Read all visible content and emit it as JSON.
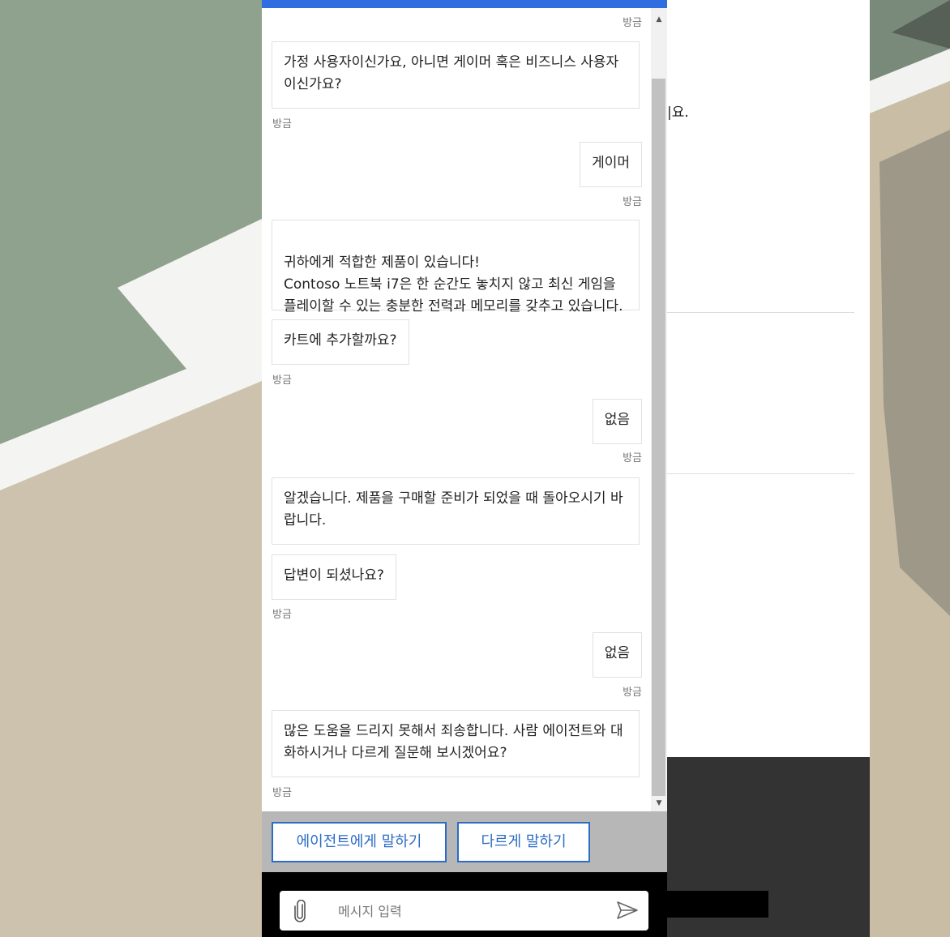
{
  "background_page": {
    "text_fragment": "|요."
  },
  "chat": {
    "colors": {
      "accent": "#2f6de1",
      "button_border": "#2b6cc4"
    },
    "messages": [
      {
        "from": "bot",
        "text": "가정 사용자이신가요, 아니면 게이머 혹은 비즈니스 사용자이신가요?",
        "time": "방금"
      },
      {
        "from": "user",
        "text": "게이머",
        "time": "방금"
      },
      {
        "from": "bot",
        "text": "귀하에게 적합한 제품이 있습니다!\nContoso 노트북 i7은 한 순간도 놓치지 않고 최신 게임을 플레이할 수 있는 충분한 전력과 메모리를 갖추고 있습니다."
      },
      {
        "from": "bot",
        "text": "카트에 추가할까요?",
        "time": "방금"
      },
      {
        "from": "user",
        "text": "없음",
        "time": "방금"
      },
      {
        "from": "bot",
        "text": "알겠습니다. 제품을 구매할 준비가 되었을 때 돌아오시기 바랍니다."
      },
      {
        "from": "bot",
        "text": "답변이 되셨나요?",
        "time": "방금"
      },
      {
        "from": "user",
        "text": "없음",
        "time": "방금"
      },
      {
        "from": "bot",
        "text": "많은 도움을 드리지 못해서 죄송합니다. 사람 에이전트와 대화하시거나 다르게 질문해 보시겠어요?",
        "time": "방금"
      }
    ],
    "top_timestamp": "방금",
    "suggested_actions": [
      "에이전트에게 말하기",
      "다르게 말하기"
    ],
    "composer": {
      "placeholder": "메시지 입력",
      "attach_icon": "paperclip-icon",
      "send_icon": "send-icon"
    }
  }
}
